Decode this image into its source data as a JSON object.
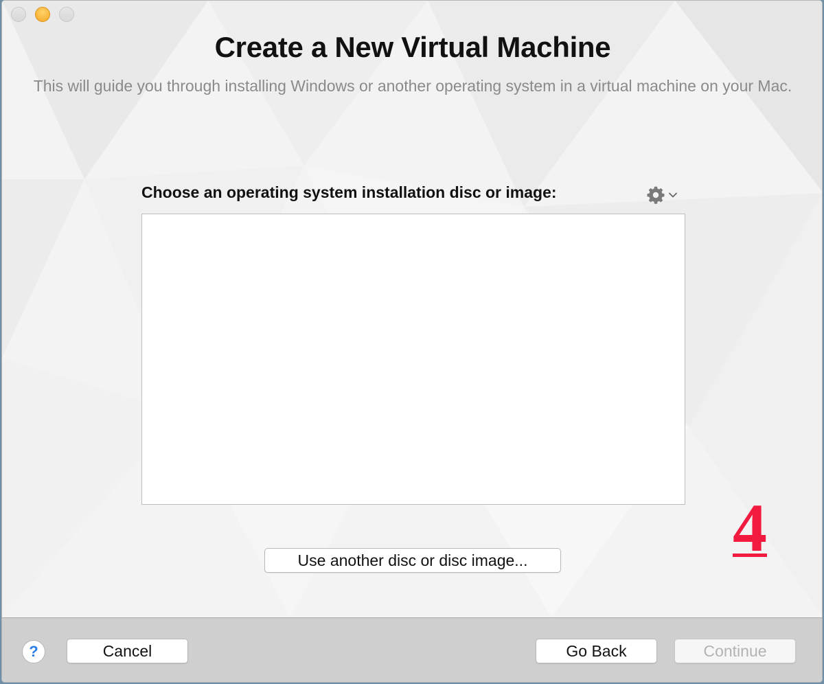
{
  "window": {
    "title": "Create a New Virtual Machine",
    "subtitle": "This will guide you through installing Windows or another operating system in a virtual machine on your Mac."
  },
  "main": {
    "choose_label": "Choose an operating system installation disc or image:",
    "gear_menu_icon": "gear-icon",
    "disc_list_items": [],
    "use_another_label": "Use another disc or disc image...",
    "step_number": "4"
  },
  "footer": {
    "help_label": "?",
    "cancel_label": "Cancel",
    "go_back_label": "Go Back",
    "continue_label": "Continue",
    "continue_enabled": false
  },
  "colors": {
    "step_number": "#f21b3f",
    "help_icon": "#2b7de9",
    "minimize_light": "#f5a623"
  }
}
